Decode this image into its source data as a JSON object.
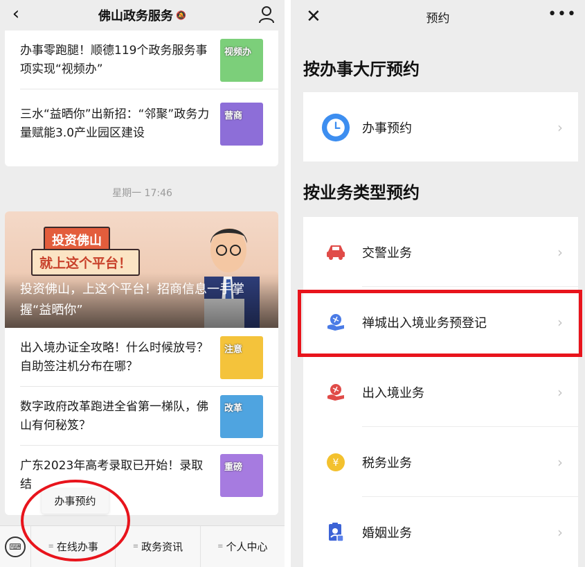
{
  "left": {
    "header": {
      "title": "佛山政务服务",
      "mute_icon": "bell-off-icon",
      "back_icon": "chevron-left-icon",
      "profile_icon": "person-icon"
    },
    "feed_top": [
      {
        "text": "办事零跑腿！顺德119个政务服务事项实现“视频办”",
        "thumb_text": "视频办",
        "thumb_color": "#7ccf7a"
      },
      {
        "text": "三水“益晒你”出新招：“邻聚”政务力量赋能3.0产业园区建设",
        "thumb_text": "营商",
        "thumb_color": "#8d6ed8"
      }
    ],
    "timestamp": "星期一 17:46",
    "hero": {
      "tag1": "投资佛山",
      "tag2": "就上这个平台！",
      "caption": "投资佛山，上这个平台！招商信息一手掌握“益晒你”"
    },
    "feed_bottom": [
      {
        "text": "出入境办证全攻略！什么时候放号？自助签注机分布在哪？",
        "thumb_text": "注意",
        "thumb_color": "#f4c33b"
      },
      {
        "text": "数字政府改革跑进全省第一梯队，佛山有何秘笈？",
        "thumb_text": "改革",
        "thumb_color": "#4fa4e0"
      },
      {
        "text": "广东2023年高考录取已开始！录取结",
        "thumb_text": "重磅",
        "thumb_color": "#a67be0"
      }
    ],
    "tooltip": "办事预约",
    "bottom_menu": [
      "在线办事",
      "政务资讯",
      "个人中心"
    ]
  },
  "right": {
    "header": {
      "title": "预约",
      "close_icon": "close-icon",
      "more_icon": "more-icon"
    },
    "section1_title": "按办事大厅预约",
    "section1_items": [
      {
        "label": "办事预约",
        "icon": "clock-icon"
      }
    ],
    "section2_title": "按业务类型预约",
    "section2_items": [
      {
        "label": "交警业务",
        "icon": "car-icon"
      },
      {
        "label": "禅城出入境业务预登记",
        "icon": "passport-hand-icon"
      },
      {
        "label": "出入境业务",
        "icon": "passport-hand-icon"
      },
      {
        "label": "税务业务",
        "icon": "yen-coin-icon"
      },
      {
        "label": "婚姻业务",
        "icon": "marriage-certificate-icon"
      }
    ]
  },
  "colors": {
    "highlight": "#e8141c",
    "background": "#ededed"
  }
}
